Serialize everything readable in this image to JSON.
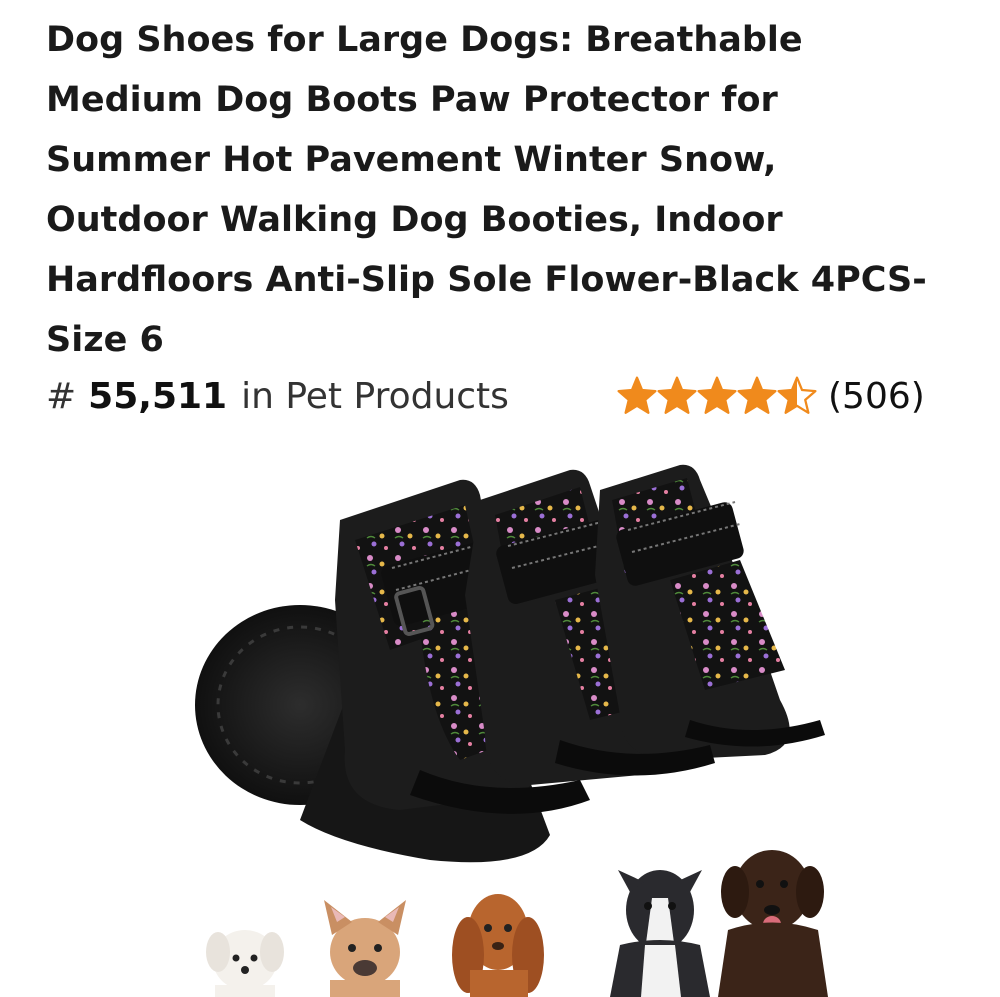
{
  "product": {
    "title_lines": [
      "Dog Shoes for Large Dogs: Breathable",
      "Medium Dog Boots Paw Protector for",
      "Summer Hot Pavement Winter Snow,",
      "Outdoor Walking Dog Booties, Indoor",
      "Hardfloors Anti-Slip Sole Flower-Black 4PCS-",
      "Size 6"
    ],
    "rank_prefix": "#",
    "rank_number": "55,511",
    "rank_category": "in Pet Products",
    "rating_value": 4.5,
    "rating_max": 5,
    "rating_count": "(506)"
  },
  "colors": {
    "star_fill": "#f08a1c",
    "title_text": "#1a1a1a"
  },
  "icons": {
    "star": "star-icon"
  }
}
